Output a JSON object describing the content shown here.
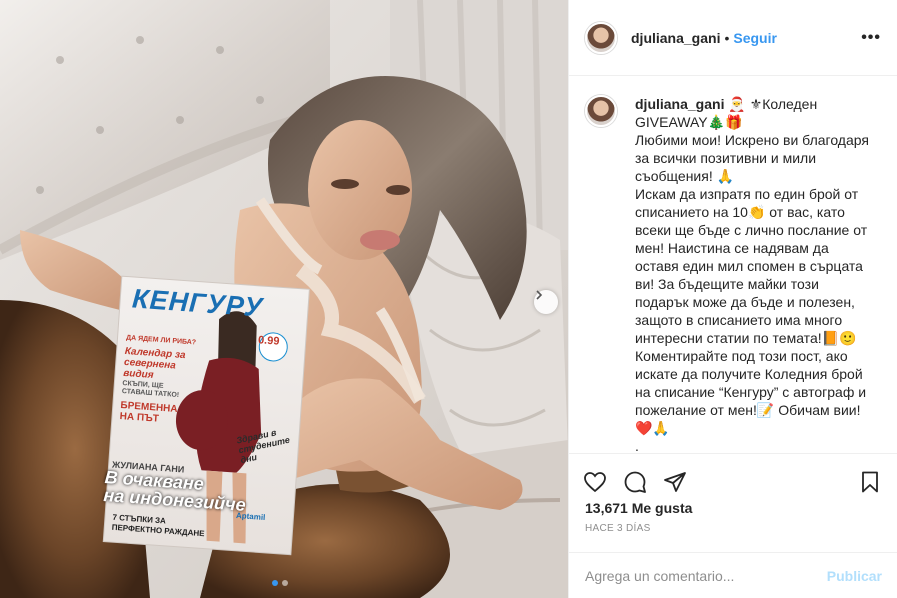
{
  "post": {
    "username": "djuliana_gani",
    "separator": "•",
    "follow_label": "Seguir",
    "more_label": "•••"
  },
  "photo": {
    "magazine_title": "КЕНГУРУ",
    "mag_line1": "ДА ЯДЕМ ЛИ РИБА?",
    "mag_line2": "Календар за\nсевернена\nвидия",
    "mag_line3": "СКЪПИ, ЩЕ\nСТАВАШ ТАТКО!",
    "mag_line4": "БРЕМЕННА\nНА ПЪТ",
    "mag_price": "0.99",
    "mag_name": "ЖУЛИАНА ГАНИ",
    "mag_headline": "В очакване\nна индонезийче",
    "mag_bottom": "7 СТЪПКИ ЗА\nПЕРФЕКТНО РАЖДАНЕ",
    "mag_side": "Здрави в\nстудените\nдни",
    "mag_brand": "Aptamil"
  },
  "caption": {
    "username": "djuliana_gani",
    "text": " 🎅 ⚜Коледен\nGIVEAWAY🎄🎁\nЛюбими мои! Искрено ви благодаря за всички позитивни и мили съобщения! 🙏\nИскам да изпратя по един брой от списанието на 10👏 от вас, като всеки ще бъде с лично послание от мен! Наистина се надявам да оставя един мил спомен в сърцата ви! За бъдещите майки този подарък може да бъде и полезен, защото в списанието има много интересни статии по темата!📙🙂\nКоментирайте под този пост, ако искате да получите Коледния брой на списание “Кенгуру” с автограф и пожелание от мен!📝 Обичам вии!\n❤️🙏\n."
  },
  "engagement": {
    "likes": "13,671 Me gusta",
    "time": "HACE 3 DÍAS"
  },
  "comment": {
    "placeholder": "Agrega un comentario...",
    "publish_label": "Publicar"
  },
  "icons": {
    "like": "heart-icon",
    "comment": "comment-icon",
    "share": "share-icon",
    "save": "bookmark-icon",
    "next": "chevron-right-icon"
  },
  "colors": {
    "link": "#3897f0",
    "publish_disabled": "#b2dffc",
    "carousel_active": "#3897f0"
  },
  "carousel": {
    "slides": 2,
    "active": 1
  }
}
